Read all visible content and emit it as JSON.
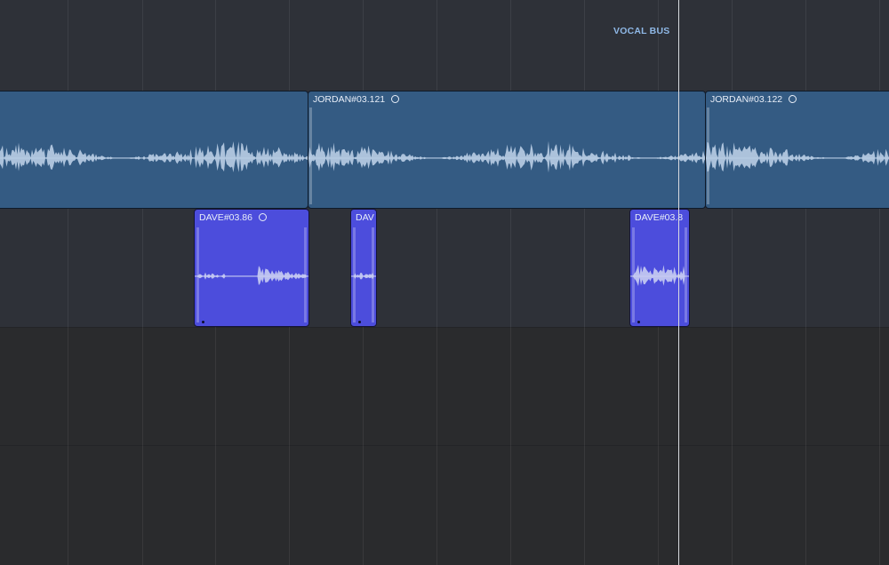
{
  "bus": {
    "label": "VOCAL BUS"
  },
  "regions": {
    "jordan_121": {
      "name": "JORDAN#03.121"
    },
    "jordan_122": {
      "name": "JORDAN#03.122"
    },
    "dave_86": {
      "name": "DAVE#03.86"
    },
    "dave_short": {
      "name": "DAV"
    },
    "dave_8": {
      "name": "DAVE#03.8"
    }
  },
  "colors": {
    "track_bg_upper": "#2e3138",
    "track_bg_lower": "#2a2b2d",
    "jordan_region": "#345b83",
    "dave_region": "#4c4ddc",
    "waveform_jordan": "#b9cde4",
    "waveform_dave": "#c8cdf2",
    "playhead": "#d9dbe0",
    "bus_label": "#8fb8e6"
  },
  "icons": {
    "loop": "loop-circle-icon"
  }
}
